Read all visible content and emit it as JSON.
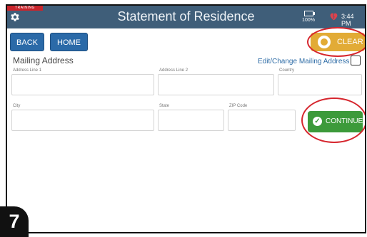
{
  "header": {
    "training_badge": "TRAINING",
    "title": "Statement of Residence",
    "battery_label": "100%",
    "time": "3:44 PM"
  },
  "nav": {
    "back_label": "BACK",
    "home_label": "HOME",
    "clear_label": "CLEAR"
  },
  "form": {
    "section_title": "Mailing Address",
    "edit_change_label": "Edit/Change Mailing Address",
    "edit_change_checked": false,
    "fields": {
      "address1_label": "Address Line 1",
      "address1_value": "",
      "address2_label": "Address Line 2",
      "address2_value": "",
      "country_label": "Country",
      "country_value": "",
      "city_label": "City",
      "city_value": "",
      "state_label": "State",
      "state_value": "",
      "zip_label": "ZIP Code",
      "zip_value": ""
    },
    "continue_label": "CONTINUE"
  },
  "step_badge": "7",
  "colors": {
    "header_bg": "#3f5e79",
    "nav_button": "#2b6aa8",
    "clear_button": "#e2ab36",
    "continue_button": "#3c9a3a",
    "highlight_ring": "#d6262e",
    "heart": "#e0424c"
  },
  "icons": {
    "settings": "gear-icon",
    "battery": "battery-icon",
    "heart": "heart-icon",
    "clear": "clear-icon",
    "continue": "check-circle-icon"
  }
}
